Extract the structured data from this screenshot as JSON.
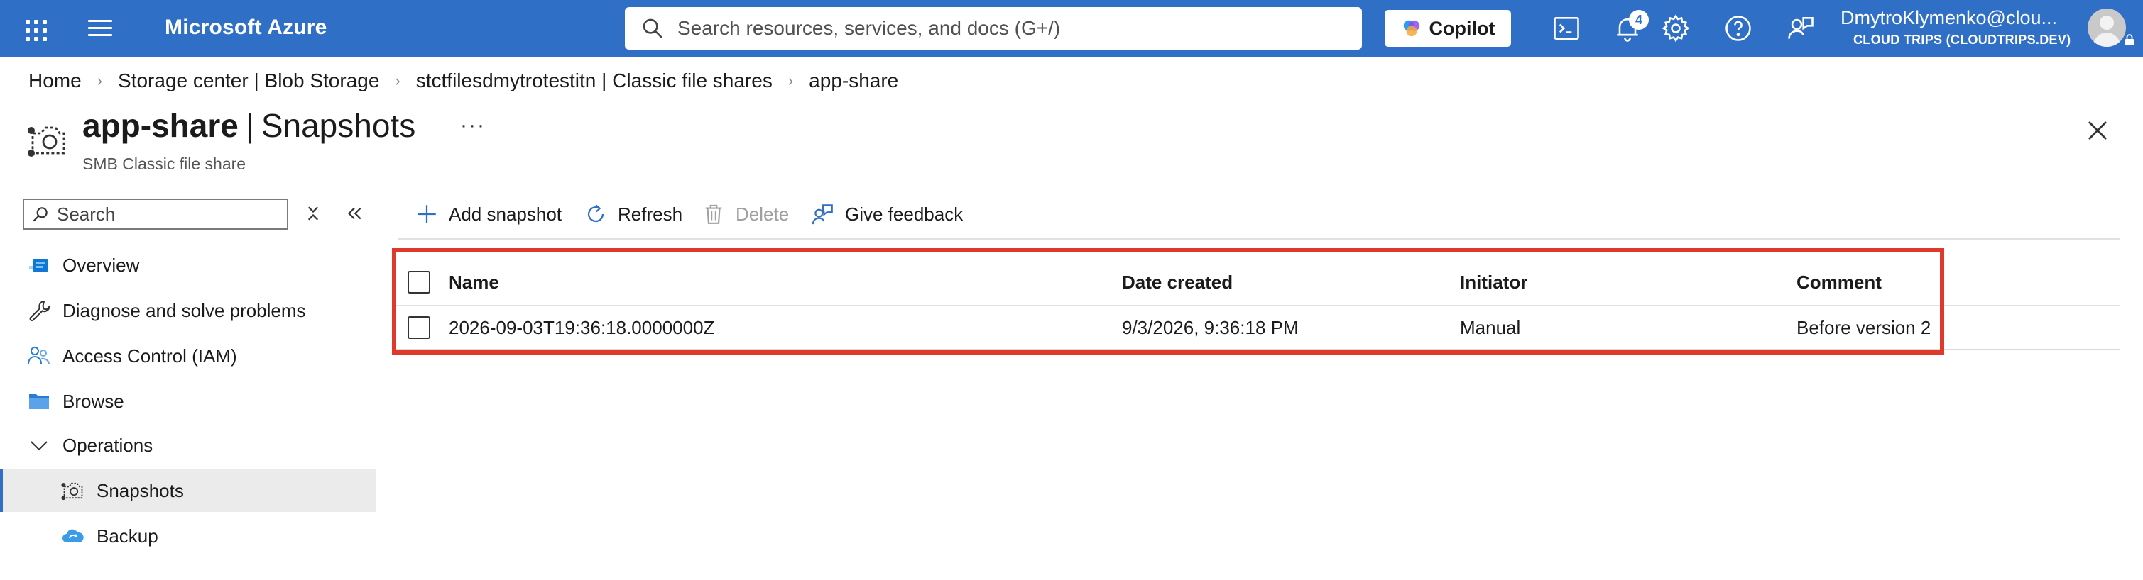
{
  "topbar": {
    "brand": "Microsoft Azure",
    "search_placeholder": "Search resources, services, and docs (G+/)",
    "copilot_label": "Copilot",
    "notifications_count": "4",
    "account_name": "DmytroKlymenko@clou...",
    "account_directory": "CLOUD TRIPS (CLOUDTRIPS.DEV)",
    "icons": [
      "waffle-icon",
      "hamburger-icon",
      "search-icon",
      "copilot-icon",
      "cloud-shell-icon",
      "bell-icon",
      "gear-icon",
      "help-icon",
      "feedback-icon",
      "avatar",
      "lock-icon"
    ]
  },
  "breadcrumb": [
    "Home",
    "Storage center | Blob Storage",
    "stctfilesdmytrotestitn | Classic file shares",
    "app-share"
  ],
  "header": {
    "resource_name": "app-share",
    "separator": "|",
    "blade_name": "Snapshots",
    "more": "···",
    "subtitle": "SMB Classic file share"
  },
  "nav": {
    "search_placeholder": "Search",
    "items": [
      {
        "label": "Overview",
        "icon": "overview-icon"
      },
      {
        "label": "Diagnose and solve problems",
        "icon": "wrench-icon"
      },
      {
        "label": "Access Control (IAM)",
        "icon": "people-icon"
      },
      {
        "label": "Browse",
        "icon": "folder-icon"
      },
      {
        "label": "Operations",
        "icon": "chevron-down-icon"
      },
      {
        "label": "Snapshots",
        "icon": "snapshot-icon"
      },
      {
        "label": "Backup",
        "icon": "backup-cloud-icon"
      }
    ]
  },
  "toolbar": {
    "add": "Add snapshot",
    "refresh": "Refresh",
    "delete": "Delete",
    "feedback": "Give feedback"
  },
  "grid": {
    "columns": [
      "Name",
      "Date created",
      "Initiator",
      "Comment"
    ],
    "rows": [
      [
        "2026-09-03T19:36:18.0000000Z",
        "9/3/2026, 9:36:18 PM",
        "Manual",
        "Before version 2"
      ]
    ]
  },
  "colors": {
    "topbar": "#2f6fc6",
    "highlight": "#e0382a",
    "selected_bg": "#ebebeb"
  }
}
